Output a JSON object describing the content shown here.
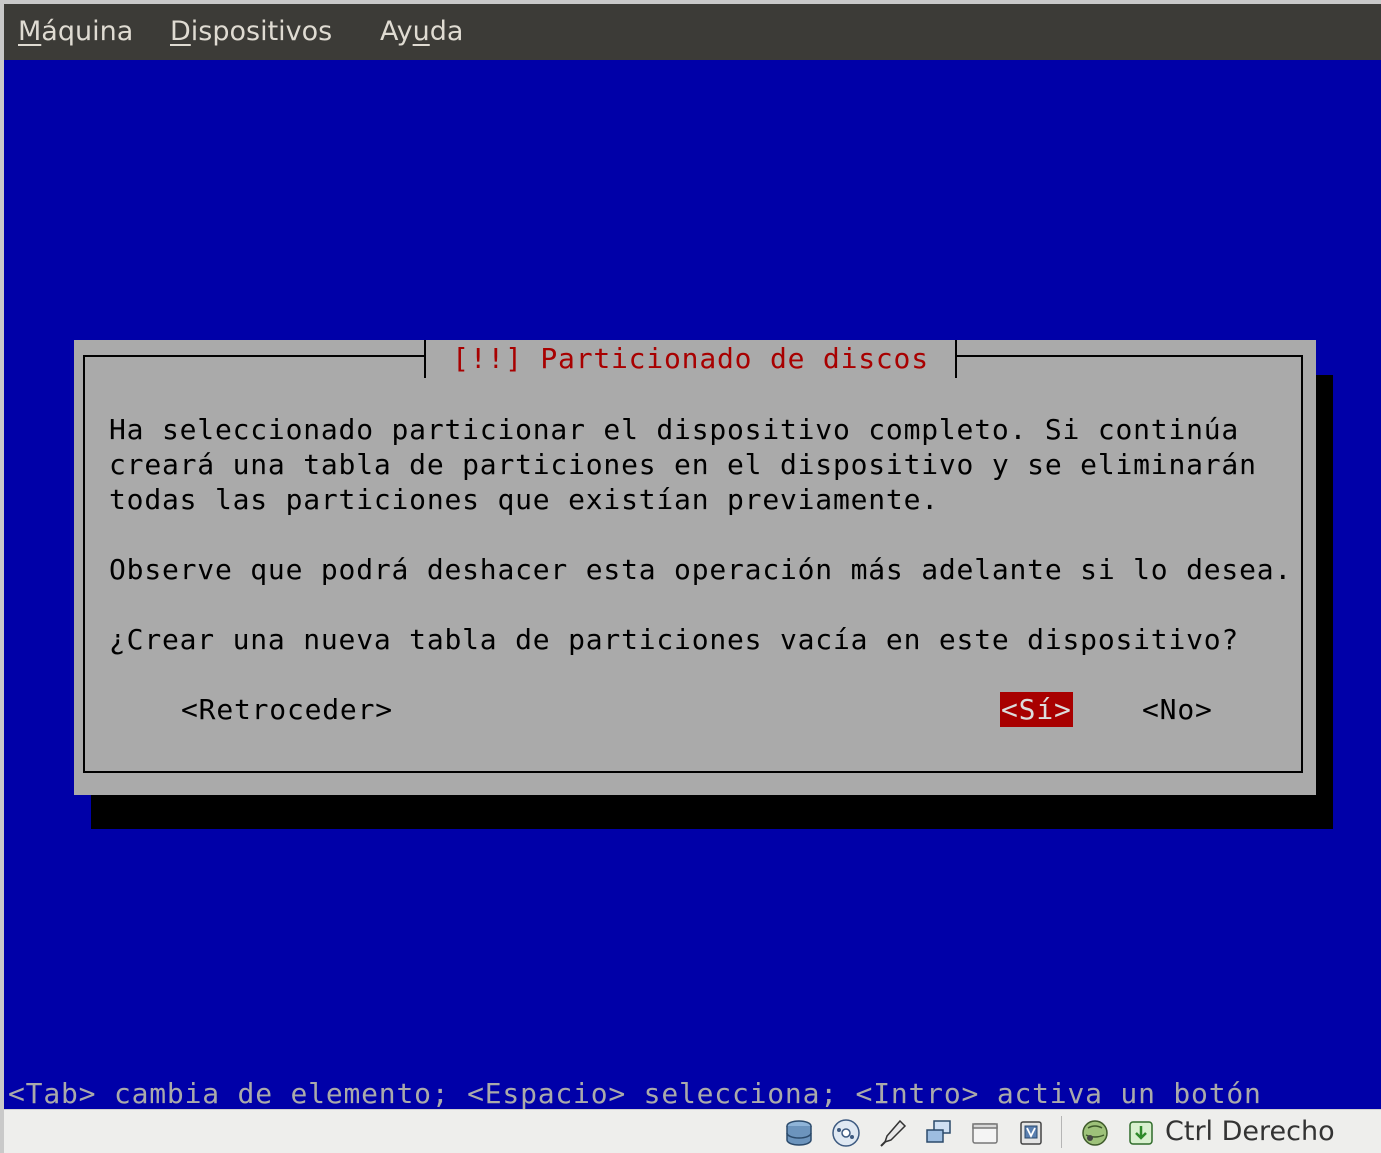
{
  "menubar": {
    "items": [
      {
        "label": "Máquina",
        "mnemonic": "M"
      },
      {
        "label": "Dispositivos",
        "mnemonic": "D"
      },
      {
        "label": "Ayuda",
        "mnemonic": "u"
      }
    ]
  },
  "dialog": {
    "title": "[!!] Particionado de discos",
    "lines": [
      "Ha seleccionado particionar el dispositivo completo. Si continúa",
      "creará una tabla de particiones en el dispositivo y se eliminarán",
      "todas las particiones que existían previamente.",
      "Observe que podrá deshacer esta operación más adelante si lo desea.",
      "¿Crear una nueva tabla de particiones vacía en este dispositivo?"
    ],
    "buttons": {
      "back": "<Retroceder>",
      "yes": "<Sí>",
      "no": "<No>"
    },
    "selected_button": "yes"
  },
  "help_line": "<Tab> cambia de elemento; <Espacio> selecciona; <Intro> activa un botón",
  "statusbar": {
    "icons": [
      "hard-disk-icon",
      "optical-drive-icon",
      "usb-icon",
      "shared-folders-icon",
      "display-icon",
      "recording-icon",
      "network-icon",
      "mouse-integration-icon"
    ],
    "host_key_label": "Ctrl Derecho"
  },
  "colors": {
    "screen_bg": "#0000a8",
    "dialog_bg": "#aaaaaa",
    "title_fg": "#a80000",
    "selected_button_bg": "#a80000"
  }
}
